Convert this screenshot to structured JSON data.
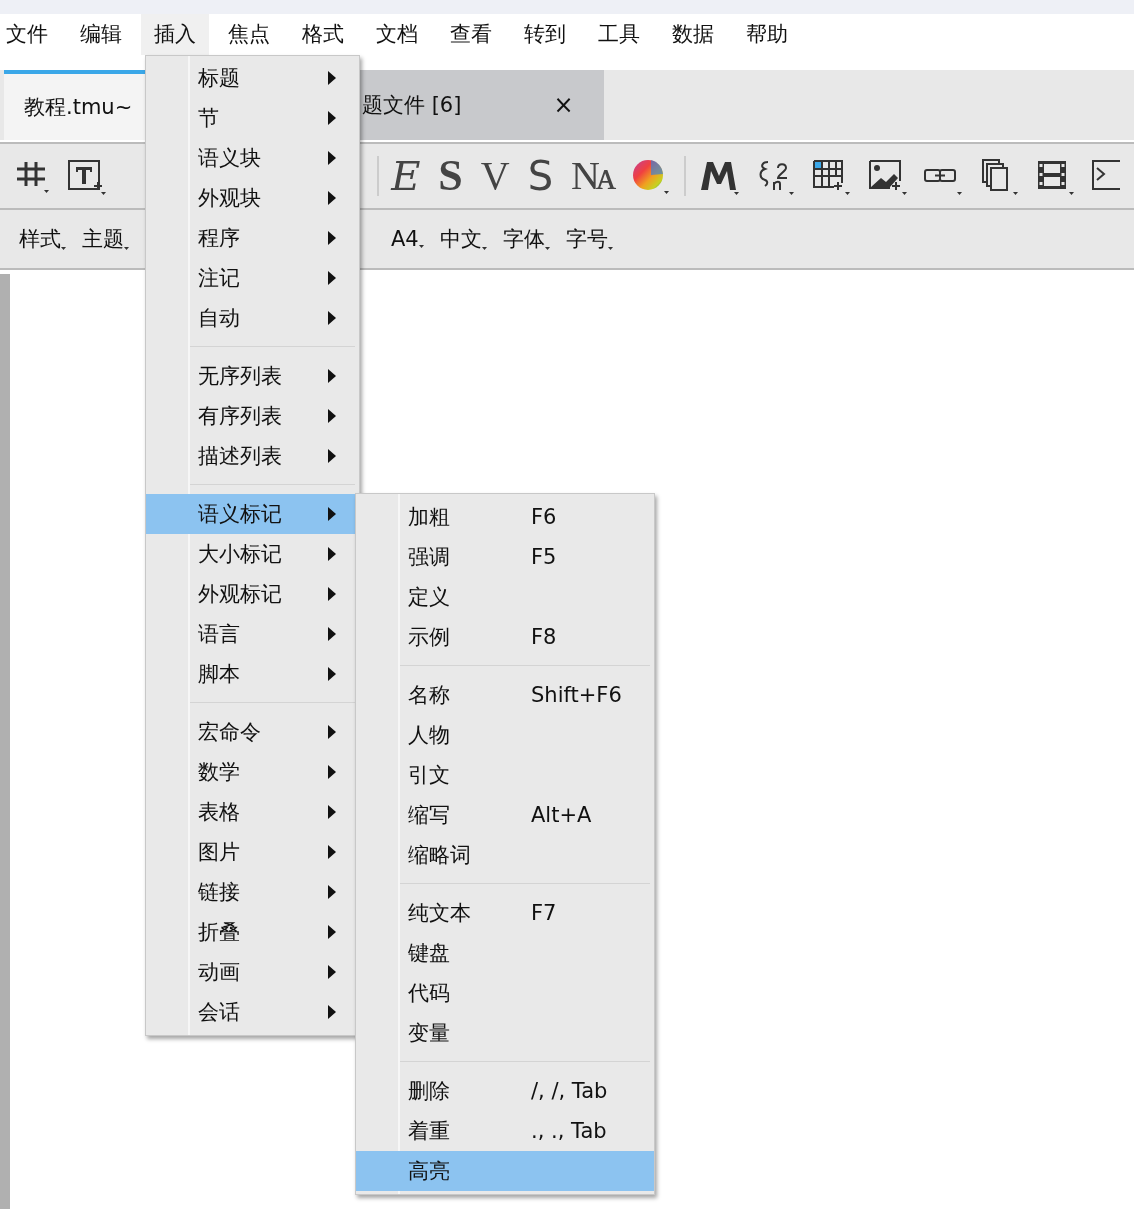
{
  "menubar": [
    {
      "label": "文件",
      "selected": false
    },
    {
      "label": "编辑",
      "selected": false
    },
    {
      "label": "插入",
      "selected": true
    },
    {
      "label": "焦点",
      "selected": false
    },
    {
      "label": "格式",
      "selected": false
    },
    {
      "label": "文档",
      "selected": false
    },
    {
      "label": "查看",
      "selected": false
    },
    {
      "label": "转到",
      "selected": false
    },
    {
      "label": "工具",
      "selected": false
    },
    {
      "label": "数据",
      "selected": false
    },
    {
      "label": "帮助",
      "selected": false
    }
  ],
  "tabs": [
    {
      "label": "教程.tmu~",
      "selected": true
    },
    {
      "label": "题文件 [6]",
      "selected": false,
      "close": "×"
    }
  ],
  "toolbar": {
    "glyphs": [
      {
        "text": "E",
        "kind": "italic"
      },
      {
        "text": "S",
        "kind": "bold"
      },
      {
        "text": "V",
        "kind": "serif"
      },
      {
        "text": "S",
        "kind": "sans"
      },
      {
        "text": "Nᴀ",
        "kind": "caps"
      }
    ]
  },
  "format_bar": [
    "样式",
    "主题",
    "A4",
    "中文",
    "字体",
    "字号"
  ],
  "menu": {
    "groups": [
      [
        {
          "label": "标题",
          "has_submenu": true,
          "selected": false
        },
        {
          "label": "节",
          "has_submenu": true,
          "selected": false
        },
        {
          "label": "语义块",
          "has_submenu": true,
          "selected": false
        },
        {
          "label": "外观块",
          "has_submenu": true,
          "selected": false
        },
        {
          "label": "程序",
          "has_submenu": true,
          "selected": false
        },
        {
          "label": "注记",
          "has_submenu": true,
          "selected": false
        },
        {
          "label": "自动",
          "has_submenu": true,
          "selected": false
        }
      ],
      [
        {
          "label": "无序列表",
          "has_submenu": true,
          "selected": false
        },
        {
          "label": "有序列表",
          "has_submenu": true,
          "selected": false
        },
        {
          "label": "描述列表",
          "has_submenu": true,
          "selected": false
        }
      ],
      [
        {
          "label": "语义标记",
          "has_submenu": true,
          "selected": true
        },
        {
          "label": "大小标记",
          "has_submenu": true,
          "selected": false
        },
        {
          "label": "外观标记",
          "has_submenu": true,
          "selected": false
        },
        {
          "label": "语言",
          "has_submenu": true,
          "selected": false
        },
        {
          "label": "脚本",
          "has_submenu": true,
          "selected": false
        }
      ],
      [
        {
          "label": "宏命令",
          "has_submenu": true,
          "selected": false
        },
        {
          "label": "数学",
          "has_submenu": true,
          "selected": false
        },
        {
          "label": "表格",
          "has_submenu": true,
          "selected": false
        },
        {
          "label": "图片",
          "has_submenu": true,
          "selected": false
        },
        {
          "label": "链接",
          "has_submenu": true,
          "selected": false
        },
        {
          "label": "折叠",
          "has_submenu": true,
          "selected": false
        },
        {
          "label": "动画",
          "has_submenu": true,
          "selected": false
        },
        {
          "label": "会话",
          "has_submenu": true,
          "selected": false
        }
      ]
    ]
  },
  "submenu": {
    "groups": [
      [
        {
          "label": "加粗",
          "shortcut": "F6",
          "selected": false
        },
        {
          "label": "强调",
          "shortcut": "F5",
          "selected": false
        },
        {
          "label": "定义",
          "selected": false
        },
        {
          "label": "示例",
          "shortcut": "F8",
          "selected": false
        }
      ],
      [
        {
          "label": "名称",
          "shortcut": "Shift+F6",
          "selected": false
        },
        {
          "label": "人物",
          "selected": false
        },
        {
          "label": "引文",
          "selected": false
        },
        {
          "label": "缩写",
          "shortcut": "Alt+A",
          "selected": false
        },
        {
          "label": "缩略词",
          "selected": false
        }
      ],
      [
        {
          "label": "纯文本",
          "shortcut": "F7",
          "selected": false
        },
        {
          "label": "键盘",
          "selected": false
        },
        {
          "label": "代码",
          "selected": false
        },
        {
          "label": "变量",
          "selected": false
        }
      ],
      [
        {
          "label": "删除",
          "shortcut": "/, /, Tab",
          "selected": false
        },
        {
          "label": "着重",
          "shortcut": "., ., Tab",
          "selected": false
        },
        {
          "label": "高亮",
          "selected": true
        }
      ]
    ]
  }
}
